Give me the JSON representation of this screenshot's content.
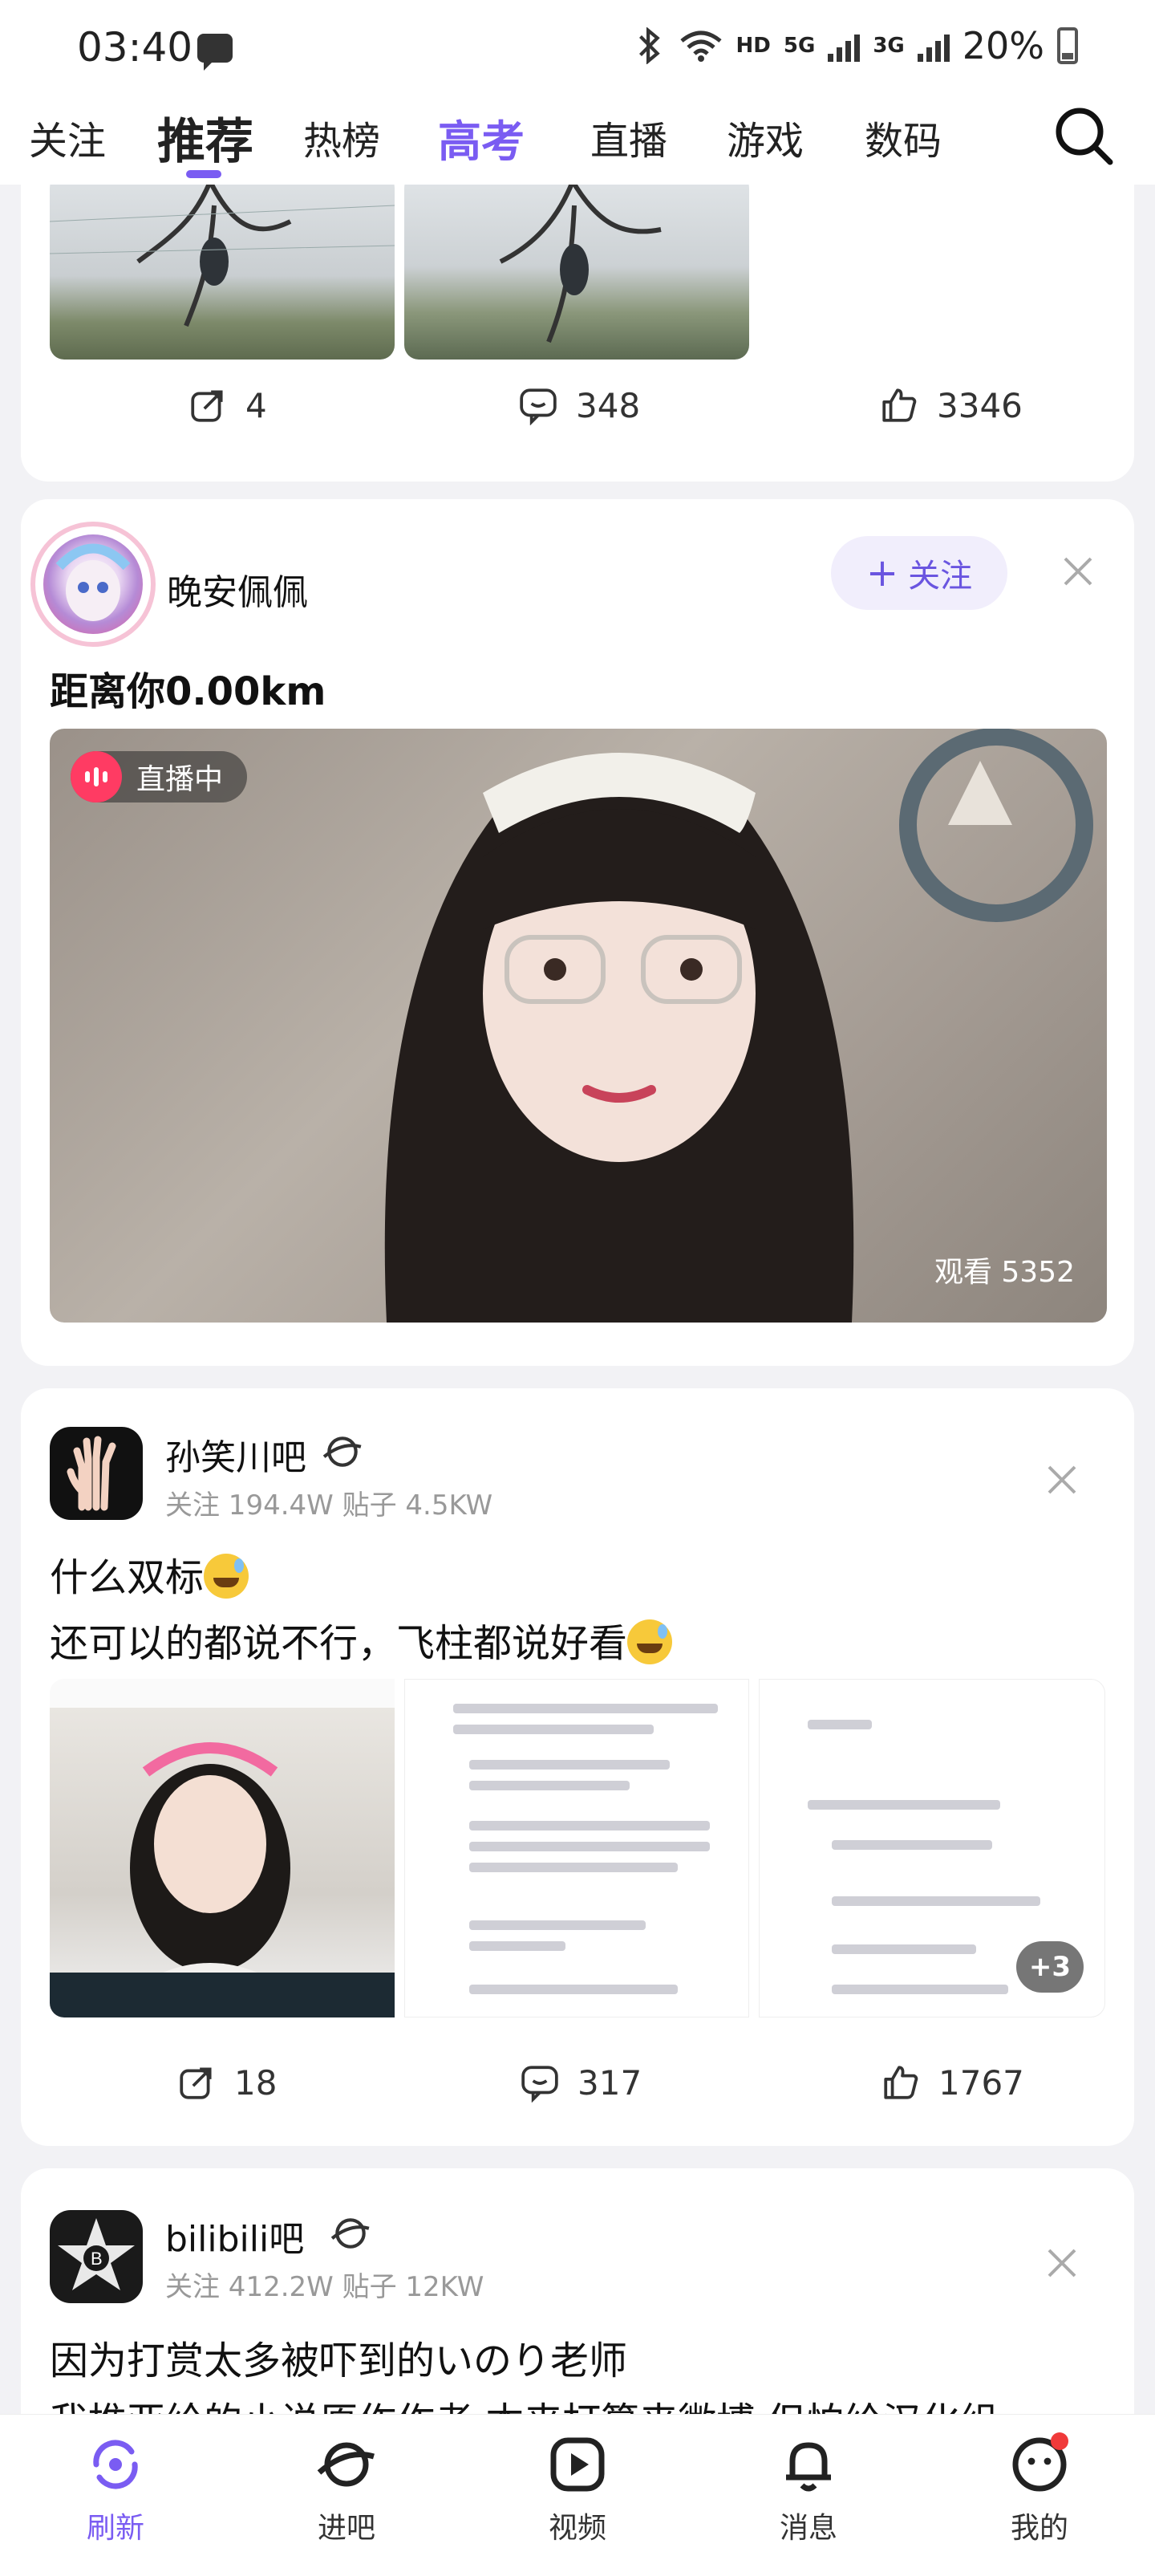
{
  "status_bar": {
    "time": "03:40",
    "network_hd": "HD",
    "net1": "5G",
    "net2": "3G",
    "battery": "20%"
  },
  "top_tabs": [
    {
      "label": "关注"
    },
    {
      "label": "推荐"
    },
    {
      "label": "热榜"
    },
    {
      "label": "高考"
    },
    {
      "label": "直播"
    },
    {
      "label": "游戏"
    },
    {
      "label": "数码"
    }
  ],
  "post1": {
    "reposts": "4",
    "comments": "348",
    "likes": "3346"
  },
  "post2": {
    "author": "晚安佩佩",
    "follow_label": "关注",
    "title": "距离你0.00km",
    "live_label": "直播中",
    "viewers": "观看 5352"
  },
  "post3": {
    "forum": "孙笑川吧",
    "stats": "关注 194.4W  贴子 4.5KW",
    "title": "什么双标",
    "body": "还可以的都说不行，飞柱都说好看",
    "more_images": "+3",
    "reposts": "18",
    "comments": "317",
    "likes": "1767"
  },
  "post4": {
    "forum": "bilibili吧",
    "stats": "关注 412.2W  贴子 12KW",
    "title": "因为打赏太多被吓到的いのり老师",
    "body": "我推亚纶的小说原作作者 本来打算来微博 但怕给汉化组"
  },
  "bottom_nav": [
    {
      "label": "刷新"
    },
    {
      "label": "进吧"
    },
    {
      "label": "视频"
    },
    {
      "label": "消息"
    },
    {
      "label": "我的"
    }
  ]
}
